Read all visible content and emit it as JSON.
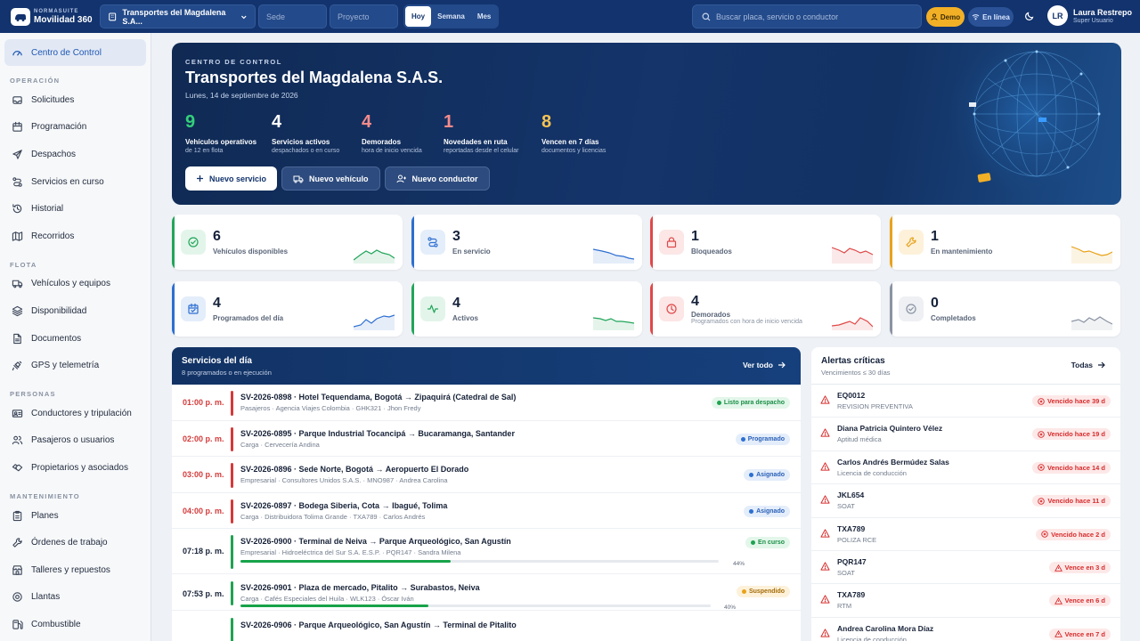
{
  "brand": {
    "suite": "NORMASUITE",
    "name": "Movilidad 360"
  },
  "topbar": {
    "company": "Transportes del Magdalena S.A...",
    "sede_placeholder": "Sede",
    "proyecto_placeholder": "Proyecto",
    "periods": [
      "Hoy",
      "Semana",
      "Mes"
    ],
    "active_period": "Hoy",
    "search_placeholder": "Buscar placa, servicio o conductor",
    "demo": "Demo",
    "online": "En línea",
    "user_initials": "LR",
    "user_name": "Laura Restrepo",
    "user_role": "Super Usuario"
  },
  "sidebar": {
    "top": {
      "label": "Centro de Control",
      "icon": "gauge-icon"
    },
    "sections": [
      {
        "title": "OPERACIÓN",
        "items": [
          {
            "label": "Solicitudes",
            "icon": "inbox-icon"
          },
          {
            "label": "Programación",
            "icon": "calendar-icon"
          },
          {
            "label": "Despachos",
            "icon": "send-icon"
          },
          {
            "label": "Servicios en curso",
            "icon": "route-icon"
          },
          {
            "label": "Historial",
            "icon": "history-icon"
          },
          {
            "label": "Recorridos",
            "icon": "map-icon"
          }
        ]
      },
      {
        "title": "FLOTA",
        "items": [
          {
            "label": "Vehículos y equipos",
            "icon": "truck-icon"
          },
          {
            "label": "Disponibilidad",
            "icon": "layers-icon"
          },
          {
            "label": "Documentos",
            "icon": "document-icon"
          },
          {
            "label": "GPS y telemetría",
            "icon": "satellite-icon"
          }
        ]
      },
      {
        "title": "PERSONAS",
        "items": [
          {
            "label": "Conductores y tripulación",
            "icon": "id-card-icon"
          },
          {
            "label": "Pasajeros o usuarios",
            "icon": "users-icon"
          },
          {
            "label": "Propietarios y asociados",
            "icon": "handshake-icon"
          }
        ]
      },
      {
        "title": "MANTENIMIENTO",
        "items": [
          {
            "label": "Planes",
            "icon": "clipboard-icon"
          },
          {
            "label": "Órdenes de trabajo",
            "icon": "wrench-icon"
          },
          {
            "label": "Talleres y repuestos",
            "icon": "store-icon"
          },
          {
            "label": "Llantas",
            "icon": "tire-icon"
          },
          {
            "label": "Combustible",
            "icon": "fuel-icon"
          }
        ]
      }
    ]
  },
  "hero": {
    "kicker": "CENTRO DE CONTROL",
    "title": "Transportes del Magdalena S.A.S.",
    "date": "Lunes, 14 de septiembre de 2026",
    "kpis": [
      {
        "value": "9",
        "label": "Vehículos operativos",
        "sub": "de 12 en flota",
        "color": "#34d07a"
      },
      {
        "value": "4",
        "label": "Servicios activos",
        "sub": "despachados o en curso",
        "color": "#ffffff"
      },
      {
        "value": "4",
        "label": "Demorados",
        "sub": "hora de inicio vencida",
        "color": "#f58b8b"
      },
      {
        "value": "1",
        "label": "Novedades en ruta",
        "sub": "reportadas desde el celular",
        "color": "#f58b8b"
      },
      {
        "value": "8",
        "label": "Vencen en 7 días",
        "sub": "documentos y licencias",
        "color": "#f6c453"
      }
    ],
    "buttons": {
      "new_service": "Nuevo servicio",
      "new_vehicle": "Nuevo vehículo",
      "new_driver": "Nuevo conductor"
    }
  },
  "stats": [
    {
      "value": "6",
      "label": "Vehículos disponibles",
      "sub": "",
      "color": "#22a55a",
      "bg": "#e3f5ea",
      "icon": "check-circle-icon"
    },
    {
      "value": "3",
      "label": "En servicio",
      "sub": "",
      "color": "#2d6fd1",
      "bg": "#e4edfa",
      "icon": "route-icon"
    },
    {
      "value": "1",
      "label": "Bloqueados",
      "sub": "",
      "color": "#e04848",
      "bg": "#fce6e6",
      "icon": "lock-icon"
    },
    {
      "value": "1",
      "label": "En mantenimiento",
      "sub": "",
      "color": "#e8a21a",
      "bg": "#fdf1da",
      "icon": "wrench-icon"
    },
    {
      "value": "4",
      "label": "Programados del día",
      "sub": "",
      "color": "#2d6fd1",
      "bg": "#e4edfa",
      "icon": "calendar-check-icon"
    },
    {
      "value": "4",
      "label": "Activos",
      "sub": "",
      "color": "#22a55a",
      "bg": "#e3f5ea",
      "icon": "activity-icon"
    },
    {
      "value": "4",
      "label": "Demorados",
      "sub": "Programados con hora de inicio vencida",
      "color": "#e04848",
      "bg": "#fce6e6",
      "icon": "clock-icon"
    },
    {
      "value": "0",
      "label": "Completados",
      "sub": "",
      "color": "#8a93a3",
      "bg": "#eef0f3",
      "icon": "check-circle-icon"
    }
  ],
  "services": {
    "title": "Servicios del día",
    "subtitle": "8 programados o en ejecución",
    "view_all": "Ver todo",
    "rows": [
      {
        "time": "01:00 p. m.",
        "title": "SV-2026-0898 · Hotel Tequendama, Bogotá → Zipaquirá (Catedral de Sal)",
        "meta": "Pasajeros · Agencia Viajes Colombia · GHK321 · Jhon Fredy",
        "status": "Listo para despacho",
        "status_kind": "ready",
        "late": true
      },
      {
        "time": "02:00 p. m.",
        "title": "SV-2026-0895 · Parque Industrial Tocancipá → Bucaramanga, Santander",
        "meta": "Carga · Cervecería Andina",
        "status": "Programado",
        "status_kind": "blue",
        "late": true
      },
      {
        "time": "03:00 p. m.",
        "title": "SV-2026-0896 · Sede Norte, Bogotá → Aeropuerto El Dorado",
        "meta": "Empresarial · Consultores Unidos S.A.S. · MNO987 · Andrea Carolina",
        "status": "Asignado",
        "status_kind": "blue",
        "late": true
      },
      {
        "time": "04:00 p. m.",
        "title": "SV-2026-0897 · Bodega Siberia, Cota → Ibagué, Tolima",
        "meta": "Carga · Distribuidora Tolima Grande · TXA789 · Carlos Andrés",
        "status": "Asignado",
        "status_kind": "blue",
        "late": true
      },
      {
        "time": "07:18 p. m.",
        "title": "SV-2026-0900 · Terminal de Neiva → Parque Arqueológico, San Agustín",
        "meta": "Empresarial · Hidroeléctrica del Sur S.A. E.S.P. · PQR147 · Sandra Milena",
        "status": "En curso",
        "status_kind": "green",
        "late": false,
        "progress": 44,
        "progress_label": "44%"
      },
      {
        "time": "07:53 p. m.",
        "title": "SV-2026-0901 · Plaza de mercado, Pitalito → Surabastos, Neiva",
        "meta": "Carga · Cafés Especiales del Huila · WLK123 · Óscar Iván",
        "status": "Suspendido",
        "status_kind": "amber",
        "late": false,
        "progress": 40,
        "progress_label": "40%"
      },
      {
        "time": "",
        "title": "SV-2026-0906 · Parque Arqueológico, San Agustín → Terminal de Pitalito",
        "meta": "",
        "status": "",
        "status_kind": "green",
        "late": false
      }
    ]
  },
  "alerts": {
    "title": "Alertas críticas",
    "subtitle": "Vencimientos ≤ 30 días",
    "all": "Todas",
    "rows": [
      {
        "name": "EQ0012",
        "sub": "REVISION PREVENTIVA",
        "badge": "Vencido hace 39 d",
        "kind": "expired"
      },
      {
        "name": "Diana Patricia Quintero Vélez",
        "sub": "Aptitud médica",
        "badge": "Vencido hace 19 d",
        "kind": "expired"
      },
      {
        "name": "Carlos Andrés Bermúdez Salas",
        "sub": "Licencia de conducción",
        "badge": "Vencido hace 14 d",
        "kind": "expired"
      },
      {
        "name": "JKL654",
        "sub": "SOAT",
        "badge": "Vencido hace 11 d",
        "kind": "expired"
      },
      {
        "name": "TXA789",
        "sub": "POLIZA RCE",
        "badge": "Vencido hace 2 d",
        "kind": "expired"
      },
      {
        "name": "PQR147",
        "sub": "SOAT",
        "badge": "Vence en 3 d",
        "kind": "soon"
      },
      {
        "name": "TXA789",
        "sub": "RTM",
        "badge": "Vence en 6 d",
        "kind": "soon"
      },
      {
        "name": "Andrea Carolina Mora Díaz",
        "sub": "Licencia de conducción",
        "badge": "Vence en 7 d",
        "kind": "soon"
      }
    ]
  }
}
